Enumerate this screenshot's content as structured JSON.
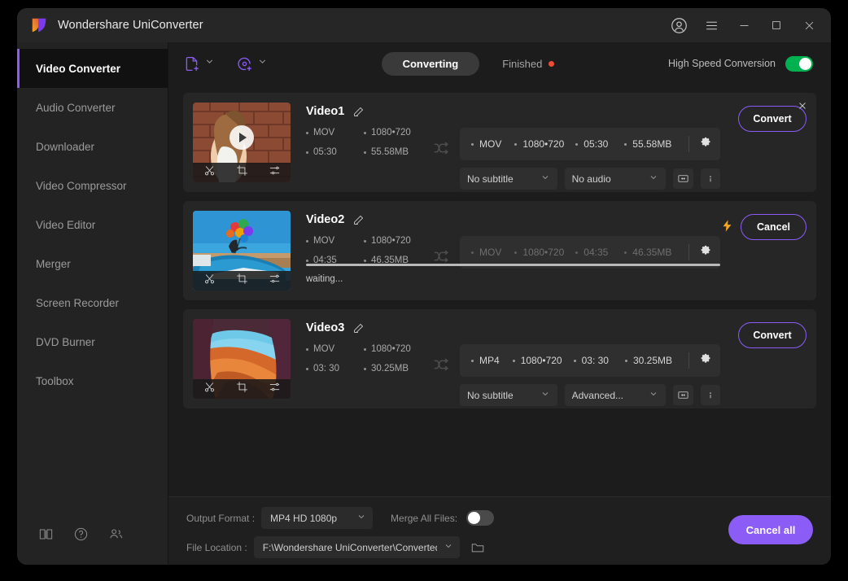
{
  "window": {
    "title": "Wondershare UniConverter",
    "controls": {
      "account": "account-icon",
      "menu": "hamburger-menu-icon",
      "minimize": "minimize-icon",
      "maximize": "maximize-icon",
      "close": "close-icon"
    },
    "accent": "#8b5cf6"
  },
  "sidebar": {
    "items": [
      {
        "label": "Video Converter",
        "active": true
      },
      {
        "label": "Audio Converter",
        "active": false
      },
      {
        "label": "Downloader",
        "active": false
      },
      {
        "label": "Video Compressor",
        "active": false
      },
      {
        "label": "Video Editor",
        "active": false
      },
      {
        "label": "Merger",
        "active": false
      },
      {
        "label": "Screen Recorder",
        "active": false
      },
      {
        "label": "DVD Burner",
        "active": false
      },
      {
        "label": "Toolbox",
        "active": false
      }
    ],
    "footer_icons": [
      "book-icon",
      "help-icon",
      "community-icon"
    ]
  },
  "toolbar": {
    "add_files_icon": "add-file-icon",
    "add_disc_icon": "add-disc-icon",
    "tabs": [
      {
        "label": "Converting",
        "active": true,
        "badge": false
      },
      {
        "label": "Finished",
        "active": false,
        "badge": true
      }
    ],
    "badge_color": "#ef4b35",
    "high_speed_label": "High Speed Conversion",
    "high_speed_on": true,
    "toggle_on_color": "#00b14f"
  },
  "videos": [
    {
      "name": "Video1",
      "source": {
        "format": "MOV",
        "resolution": "1080•720",
        "duration": "05:30",
        "size": "55.58MB"
      },
      "output": {
        "format": "MOV",
        "resolution": "1080•720",
        "duration": "05:30",
        "size": "55.58MB"
      },
      "subtitle": "No subtitle",
      "audio": "No audio",
      "action": "Convert",
      "state": "idle",
      "dimmed": false,
      "closable": true,
      "bolt": false,
      "progress_status": "",
      "thumb": "woman-brick-wall"
    },
    {
      "name": "Video2",
      "source": {
        "format": "MOV",
        "resolution": "1080•720",
        "duration": "04:35",
        "size": "46.35MB"
      },
      "output": {
        "format": "MOV",
        "resolution": "1080•720",
        "duration": "04:35",
        "size": "46.35MB"
      },
      "subtitle": "",
      "audio": "",
      "action": "Cancel",
      "state": "waiting",
      "dimmed": true,
      "closable": false,
      "bolt": true,
      "progress_status": "waiting...",
      "thumb": "car-balloons"
    },
    {
      "name": "Video3",
      "source": {
        "format": "MOV",
        "resolution": "1080•720",
        "duration": "03: 30",
        "size": "30.25MB"
      },
      "output": {
        "format": "MP4",
        "resolution": "1080•720",
        "duration": "03: 30",
        "size": "30.25MB"
      },
      "subtitle": "No subtitle",
      "audio": "Advanced...",
      "action": "Convert",
      "state": "idle",
      "dimmed": false,
      "closable": false,
      "bolt": false,
      "progress_status": "",
      "thumb": "canyon"
    }
  ],
  "bottom": {
    "output_format_label": "Output Format :",
    "output_format_value": "MP4 HD 1080p",
    "merge_label": "Merge All Files:",
    "merge_on": false,
    "file_location_label": "File Location :",
    "file_location_value": "F:\\Wondershare UniConverter\\Converted",
    "folder_icon": "folder-icon",
    "cancel_all_label": "Cancel all"
  }
}
